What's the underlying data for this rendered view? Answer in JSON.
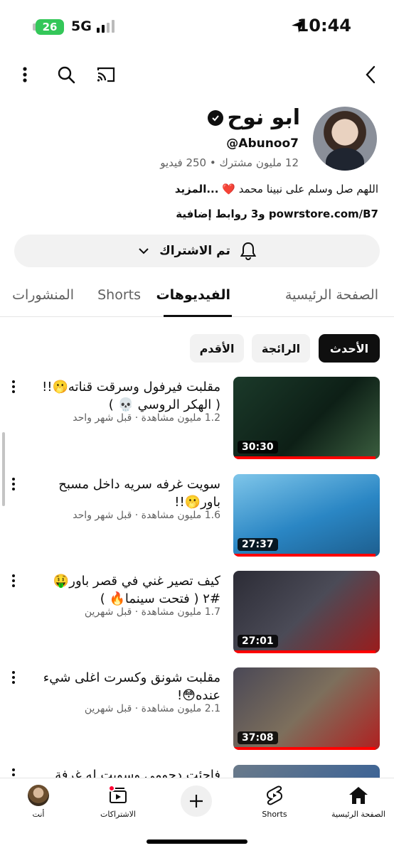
{
  "status_bar": {
    "battery": "26",
    "network": "5G",
    "time": "10:44"
  },
  "channel": {
    "name": "ابو نوح",
    "handle": "@Abunoo7",
    "stats": "12 مليون مشترك • 250 فيديو",
    "description": "اللهم صل وسلم على نبينا محمد",
    "description_more": "...المزيد",
    "links": "powrstore.com/B7 و3 روابط إضافية"
  },
  "subscribe": {
    "label": "تم الاشتراك"
  },
  "tabs": [
    {
      "label": "الصفحة الرئيسية"
    },
    {
      "label": "الفيديوهات"
    },
    {
      "label": "Shorts"
    },
    {
      "label": "المنشورات"
    }
  ],
  "chips": [
    {
      "label": "الأحدث"
    },
    {
      "label": "الرائجة"
    },
    {
      "label": "الأقدم"
    }
  ],
  "videos": [
    {
      "title": "مقلبت فيرفول وسرقت قناته🫢!! ( الهكر الروسي 💀 )",
      "meta": "1.2 مليون مشاهدة · قبل شهر واحد",
      "duration": "30:30",
      "watched": 0.97,
      "bg": "#1b3a2a"
    },
    {
      "title": "سويت غرفه سريه داخل مسبح باور🫢!!",
      "meta": "1.6 مليون مشاهدة · قبل شهر واحد",
      "duration": "27:37",
      "watched": 0.97,
      "bg": "#4aa3d6"
    },
    {
      "title": "كيف تصير غني في قصر باور🤑 #٢ ( فتحت سينما🔥 )",
      "meta": "1.7 مليون مشاهدة · قبل شهرين",
      "duration": "27:01",
      "watched": 0.97,
      "bg": "#3a3a44"
    },
    {
      "title": "مقلبت شونق وكسرت اغلى شيء عنده😳!",
      "meta": "2.1 مليون مشاهدة · قبل شهرين",
      "duration": "37:08",
      "watched": 0.97,
      "bg": "#5c5a66"
    },
    {
      "title": "فاجئت دحومي وسويت له غرفة",
      "meta": "",
      "duration": "",
      "watched": 0,
      "bg": "#6a7a8a"
    }
  ],
  "bottom_nav": [
    {
      "label": "الصفحة الرئيسية"
    },
    {
      "label": "Shorts"
    },
    {
      "label": "الاشتراكات"
    },
    {
      "label": "أنت"
    }
  ]
}
